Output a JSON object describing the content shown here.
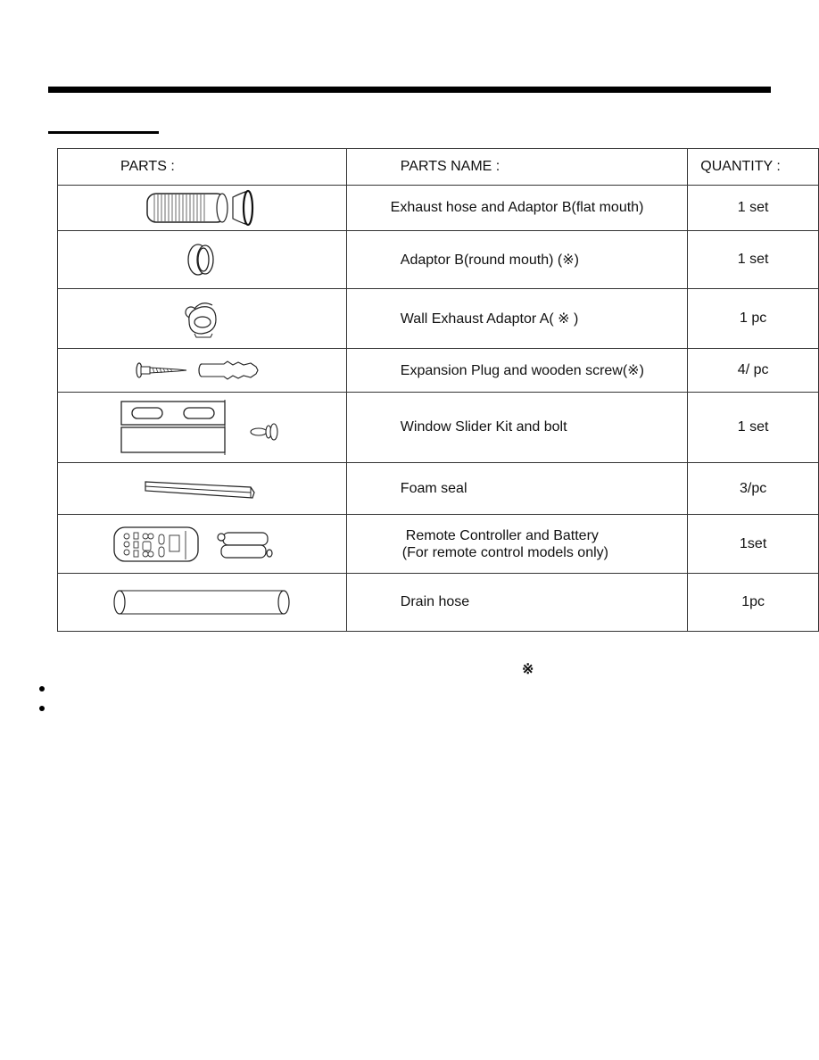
{
  "table": {
    "headers": {
      "parts": "PARTS :",
      "parts_name": "PARTS NAME :",
      "quantity": "QUANTITY :"
    },
    "rows": [
      {
        "icon": "exhaust-hose-icon",
        "name": "Exhaust hose and Adaptor B(flat mouth)",
        "quantity": "1 set"
      },
      {
        "icon": "round-adaptor-icon",
        "name": "Adaptor B(round mouth) (※)",
        "quantity": "1 set"
      },
      {
        "icon": "wall-adaptor-icon",
        "name": "Wall Exhaust Adaptor A( ※ )",
        "quantity": "1 pc"
      },
      {
        "icon": "screw-plug-icon",
        "name": "Expansion Plug and wooden  screw(※)",
        "quantity": "4/ pc"
      },
      {
        "icon": "window-slider-icon",
        "name": "Window Slider Kit and bolt",
        "quantity": "1 set"
      },
      {
        "icon": "foam-seal-icon",
        "name": "Foam seal",
        "quantity": "3/pc"
      },
      {
        "icon": "remote-battery-icon",
        "name_line1": "Remote Controller and Battery",
        "name_line2": "(For remote control models only)",
        "quantity": "1set"
      },
      {
        "icon": "drain-hose-icon",
        "name": "Drain hose",
        "quantity": "1pc"
      }
    ]
  },
  "notes": {
    "mark": "※",
    "bullets": [
      "",
      ""
    ]
  }
}
